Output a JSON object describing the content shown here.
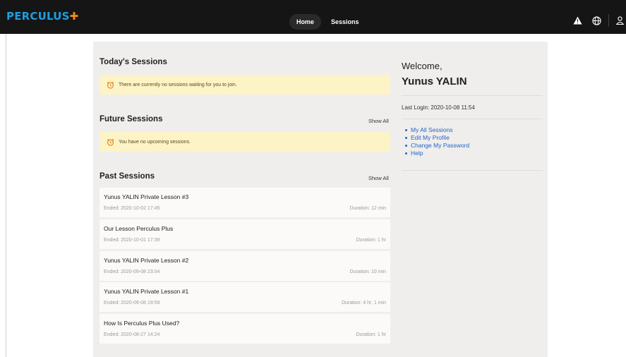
{
  "brand": {
    "name": "PERCULUS",
    "plus": "✚",
    "color": "#1e9ee0",
    "accent": "#f08a1c"
  },
  "nav": {
    "home": "Home",
    "sessions": "Sessions"
  },
  "toolbar_icons": [
    "warning-icon",
    "globe-icon",
    "user-icon"
  ],
  "today": {
    "title": "Today's Sessions",
    "notice": "There are currently no sessions waiting for you to join."
  },
  "future": {
    "title": "Future Sessions",
    "show_all": "Show All",
    "notice": "You have no upcoming sessions."
  },
  "past": {
    "title": "Past Sessions",
    "show_all": "Show All",
    "sessions": [
      {
        "title": "Yunus YALIN Private Lesson #3",
        "ended": "Ended: 2020-10-02 17:45",
        "duration": "Duration: 12 min"
      },
      {
        "title": "Our Lesson Perculus Plus",
        "ended": "Ended: 2020-10-01 17:39",
        "duration": "Duration: 1 hr"
      },
      {
        "title": "Yunus YALIN Private Lesson #2",
        "ended": "Ended: 2020-09-08 23:04",
        "duration": "Duration: 10 min"
      },
      {
        "title": "Yunus YALIN Private Lesson #1",
        "ended": "Ended: 2020-09-08 19:59",
        "duration": "Duration: 4 hr, 1 min"
      },
      {
        "title": "How Is Perculus Plus Used?",
        "ended": "Ended: 2020-08-27 14:24",
        "duration": "Duration: 1 hr"
      }
    ]
  },
  "sidebar": {
    "welcome": "Welcome,",
    "user": "Yunus YALIN",
    "last_login": "Last Login:  2020-10-08 11:54",
    "links": [
      "My All Sessions",
      "Edit My Profile",
      "Change My Password",
      "Help"
    ]
  }
}
